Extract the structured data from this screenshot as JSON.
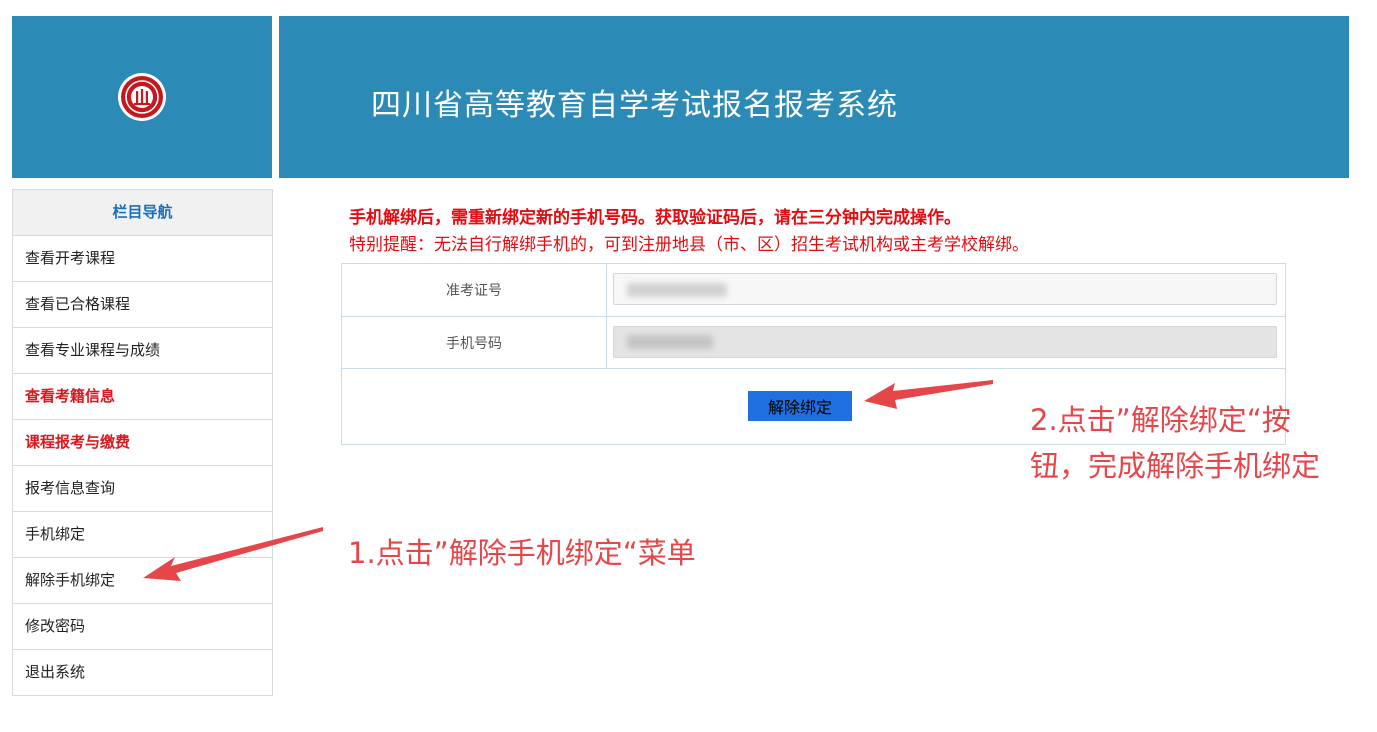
{
  "header": {
    "title": "四川省高等教育自学考试报名报考系统"
  },
  "sidebar": {
    "title": "栏目导航",
    "items": [
      {
        "label": "查看开考课程"
      },
      {
        "label": "查看已合格课程"
      },
      {
        "label": "查看专业课程与成绩"
      },
      {
        "label": "查看考籍信息"
      },
      {
        "label": "课程报考与缴费"
      },
      {
        "label": "报考信息查询"
      },
      {
        "label": "手机绑定"
      },
      {
        "label": "解除手机绑定"
      },
      {
        "label": "修改密码"
      },
      {
        "label": "退出系统"
      }
    ]
  },
  "notice": {
    "line1": "手机解绑后，需重新绑定新的手机号码。获取验证码后，请在三分钟内完成操作。",
    "line2": "特别提醒：无法自行解绑手机的，可到注册地县（市、区）招生考试机构或主考学校解绑。"
  },
  "form": {
    "exam_id_label": "准考证号",
    "exam_id_value": "",
    "phone_label": "手机号码",
    "phone_value": "",
    "unbind_button": "解除绑定"
  },
  "annotations": {
    "step1": "1.点击”解除手机绑定“菜单",
    "step2_line1": "2.点击”解除绑定“按",
    "step2_line2": "钮，完成解除手机绑定"
  },
  "colors": {
    "header_bg": "#2b8ab6",
    "alert_red": "#e20d10",
    "annotation_red": "#e5464a",
    "button_blue": "#1f6fe0",
    "nav_title_blue": "#1d6fb8"
  },
  "icons": {
    "logo": "seal-logo-icon"
  }
}
